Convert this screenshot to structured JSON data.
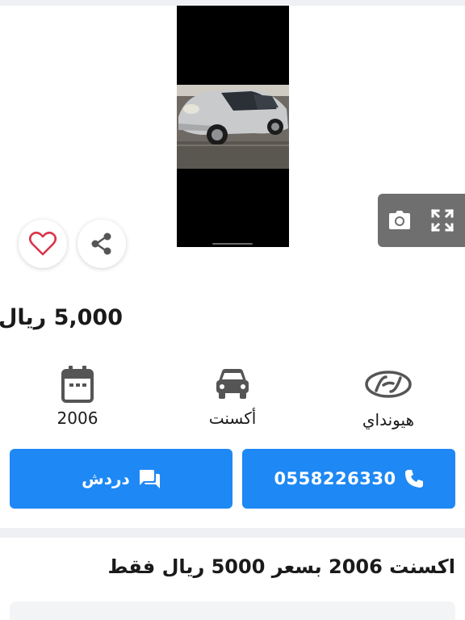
{
  "gallery": {
    "photo_alt": "silver sedan",
    "tools": {
      "camera_icon": "camera-icon",
      "expand_icon": "fullscreen-icon"
    },
    "favorite_icon": "heart-outline-icon",
    "share_icon": "share-icon"
  },
  "listing": {
    "price": "5,000 ريال",
    "title": "اكسنت 2006 بسعر 5000 ريال فقط"
  },
  "specs": [
    {
      "icon": "calendar-icon",
      "label": "2006"
    },
    {
      "icon": "car-icon",
      "label": "أكسنت"
    },
    {
      "icon": "hyundai-logo-icon",
      "label": "هيونداي"
    }
  ],
  "actions": {
    "chat_label": "دردش",
    "chat_icon": "chat-icon",
    "call_number": "0558226330",
    "call_icon": "phone-icon"
  },
  "colors": {
    "accent": "#1e88f5",
    "heart": "#d9354a",
    "icon_gray": "#555555",
    "band": "#eef0f3"
  }
}
